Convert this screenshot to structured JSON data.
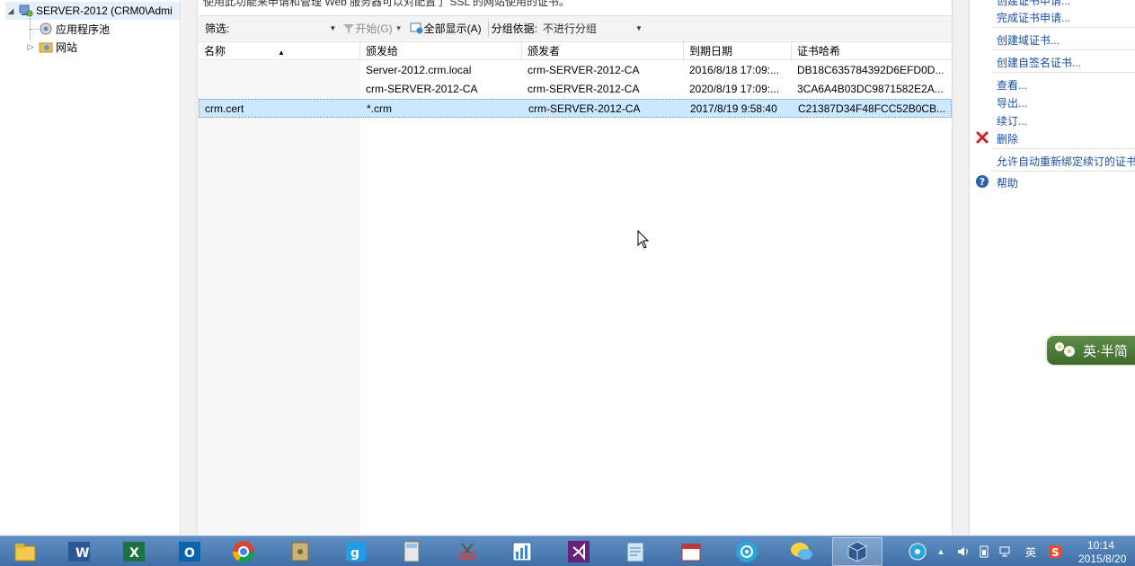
{
  "tree": {
    "server": "SERVER-2012 (CRM0\\Admi",
    "app_pools": "应用程序池",
    "sites": "网站"
  },
  "center": {
    "description": "使用此功能来申请和管理 Web 服务器可以对配置了 SSL 的网站使用的证书。",
    "filter_label": "筛选:",
    "start_label": "开始(G)",
    "show_all_label": "全部显示(A)",
    "group_by_label": "分组依据:",
    "group_by_value": "不进行分组"
  },
  "table": {
    "columns": [
      "名称",
      "颁发给",
      "颁发者",
      "到期日期",
      "证书哈希"
    ],
    "rows": [
      {
        "name": "",
        "issued_to": "Server-2012.crm.local",
        "issuer": "crm-SERVER-2012-CA",
        "expires": "2016/8/18 17:09:...",
        "hash": "DB18C635784392D6EFD0D..."
      },
      {
        "name": "",
        "issued_to": "crm-SERVER-2012-CA",
        "issuer": "crm-SERVER-2012-CA",
        "expires": "2020/8/19 17:09:...",
        "hash": "3CA6A4B03DC9871582E2A..."
      },
      {
        "name": "crm.cert",
        "issued_to": "*.crm",
        "issuer": "crm-SERVER-2012-CA",
        "expires": "2017/8/19 9:58:40",
        "hash": "C21387D34F48FCC52B0CB..."
      }
    ]
  },
  "actions": {
    "complete_request": "完成证书申请...",
    "create_domain_cert": "创建域证书...",
    "create_self_signed": "创建自签名证书...",
    "view": "查看...",
    "export": "导出...",
    "renew": "续订...",
    "delete": "删除",
    "auto_rebind": "允许自动重新绑定续订的证书",
    "help": "帮助"
  },
  "ime": {
    "text": "英·半简"
  },
  "taskbar": {
    "tray_lang": "英",
    "time": "10:14",
    "date": "2015/8/20"
  },
  "colors": {
    "accent": "#1a4ea3",
    "selection": "#cce8ff",
    "taskbar": "#4a7ab3"
  }
}
